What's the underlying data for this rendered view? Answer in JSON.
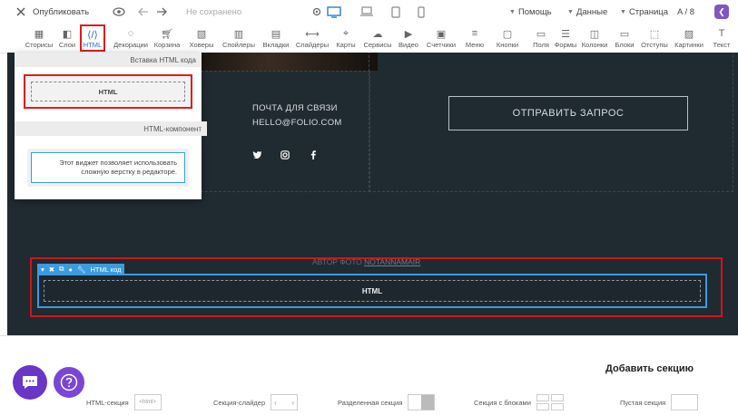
{
  "topbar": {
    "publish": "Опубликовать",
    "save_status": "Не сохранено",
    "help": "Помощь",
    "data": "Данные",
    "page": "Страница",
    "page_index": "A / 8"
  },
  "toolbar": {
    "items": [
      {
        "label": "Текст",
        "icon": "text-icon"
      },
      {
        "label": "Картинки",
        "icon": "image-icon"
      },
      {
        "label": "Отступы",
        "icon": "spacing-icon"
      },
      {
        "label": "Блоки",
        "icon": "blocks-icon"
      },
      {
        "label": "Колонки",
        "icon": "columns-icon"
      },
      {
        "label": "Формы",
        "icon": "forms-icon"
      },
      {
        "label": "Поля",
        "icon": "fields-icon"
      },
      {
        "label": "Кнопки",
        "icon": "buttons-icon"
      },
      {
        "label": "Меню",
        "icon": "menu-icon"
      },
      {
        "label": "Счетчики",
        "icon": "counter-icon"
      },
      {
        "label": "Видео",
        "icon": "video-icon"
      },
      {
        "label": "Сервисы",
        "icon": "services-icon"
      },
      {
        "label": "Карты",
        "icon": "map-icon"
      },
      {
        "label": "Слайдеры",
        "icon": "slider-icon"
      },
      {
        "label": "Вкладки",
        "icon": "tabs-icon"
      },
      {
        "label": "Спойлеры",
        "icon": "spoiler-icon"
      },
      {
        "label": "Ховеры",
        "icon": "hover-icon"
      },
      {
        "label": "Корзина",
        "icon": "cart-icon"
      },
      {
        "label": "Декорации",
        "icon": "decor-icon"
      },
      {
        "label": "HTML",
        "icon": "html-code-icon"
      },
      {
        "label": "Слои",
        "icon": "layers-icon"
      },
      {
        "label": "Сторисы",
        "icon": "stories-icon"
      }
    ]
  },
  "panel": {
    "section1": "Вставка HTML кода",
    "html_tile": "HTML",
    "section2": "HTML-компонент",
    "component_line1": "Этот виджет позволяет использовать",
    "component_line2": "сложную верстку в редакторе."
  },
  "canvas": {
    "contact_title": "ПОЧТА ДЛЯ СВЯЗИ",
    "contact_email": "HELLO@FOLIO.COM",
    "send_button": "ОТПРАВИТЬ ЗАПРОС",
    "credit_prefix": "АВТОР ФОТО",
    "credit_link": "NOTANNAMAIR",
    "selected_tab": "HTML код",
    "selected_content": "HTML"
  },
  "bottom": {
    "title": "Добавить секцию",
    "options": [
      {
        "label": "Пустая секция"
      },
      {
        "label": "Секция с блоками"
      },
      {
        "label": "Разделенная секция"
      },
      {
        "label": "Секция-слайдер"
      },
      {
        "label": "HTML-секция",
        "thumb_text": "<html>"
      }
    ]
  }
}
